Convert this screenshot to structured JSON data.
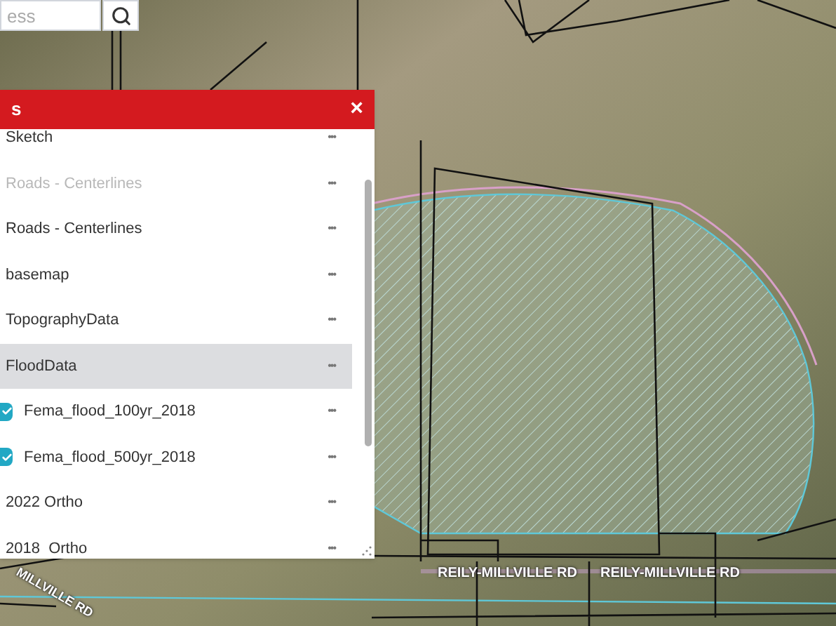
{
  "search": {
    "placeholder": "ess"
  },
  "panel": {
    "title": "s",
    "close": "×",
    "layers": [
      {
        "kind": "layer",
        "label": "Sketch",
        "disabled": false,
        "selected": false,
        "menu": "•••"
      },
      {
        "kind": "layer",
        "label": "Roads - Centerlines",
        "disabled": true,
        "selected": false,
        "menu": "•••"
      },
      {
        "kind": "layer",
        "label": "Roads - Centerlines",
        "disabled": false,
        "selected": false,
        "menu": "•••"
      },
      {
        "kind": "layer",
        "label": "basemap",
        "disabled": false,
        "selected": false,
        "menu": "•••"
      },
      {
        "kind": "layer",
        "label": "TopographyData",
        "disabled": false,
        "selected": false,
        "menu": "•••"
      },
      {
        "kind": "layer",
        "label": "FloodData",
        "disabled": false,
        "selected": true,
        "menu": "•••"
      },
      {
        "kind": "sublayer",
        "label": "Fema_flood_100yr_2018",
        "checked": true,
        "selected": false,
        "menu": "•••"
      },
      {
        "kind": "sublayer",
        "label": "Fema_flood_500yr_2018",
        "checked": true,
        "selected": false,
        "menu": "•••"
      },
      {
        "kind": "layer",
        "label": "2022 Ortho",
        "disabled": false,
        "selected": false,
        "menu": "•••"
      },
      {
        "kind": "layer",
        "label": "2018  Ortho",
        "disabled": false,
        "selected": false,
        "menu": "•••"
      }
    ]
  },
  "road_labels": [
    {
      "text": "MILLVILLE RD",
      "kind": "rotated"
    },
    {
      "text": "REILY-MILLVILLE RD",
      "kind": "flat"
    },
    {
      "text": "REILY-MILLVILLE RD",
      "kind": "flat"
    }
  ]
}
